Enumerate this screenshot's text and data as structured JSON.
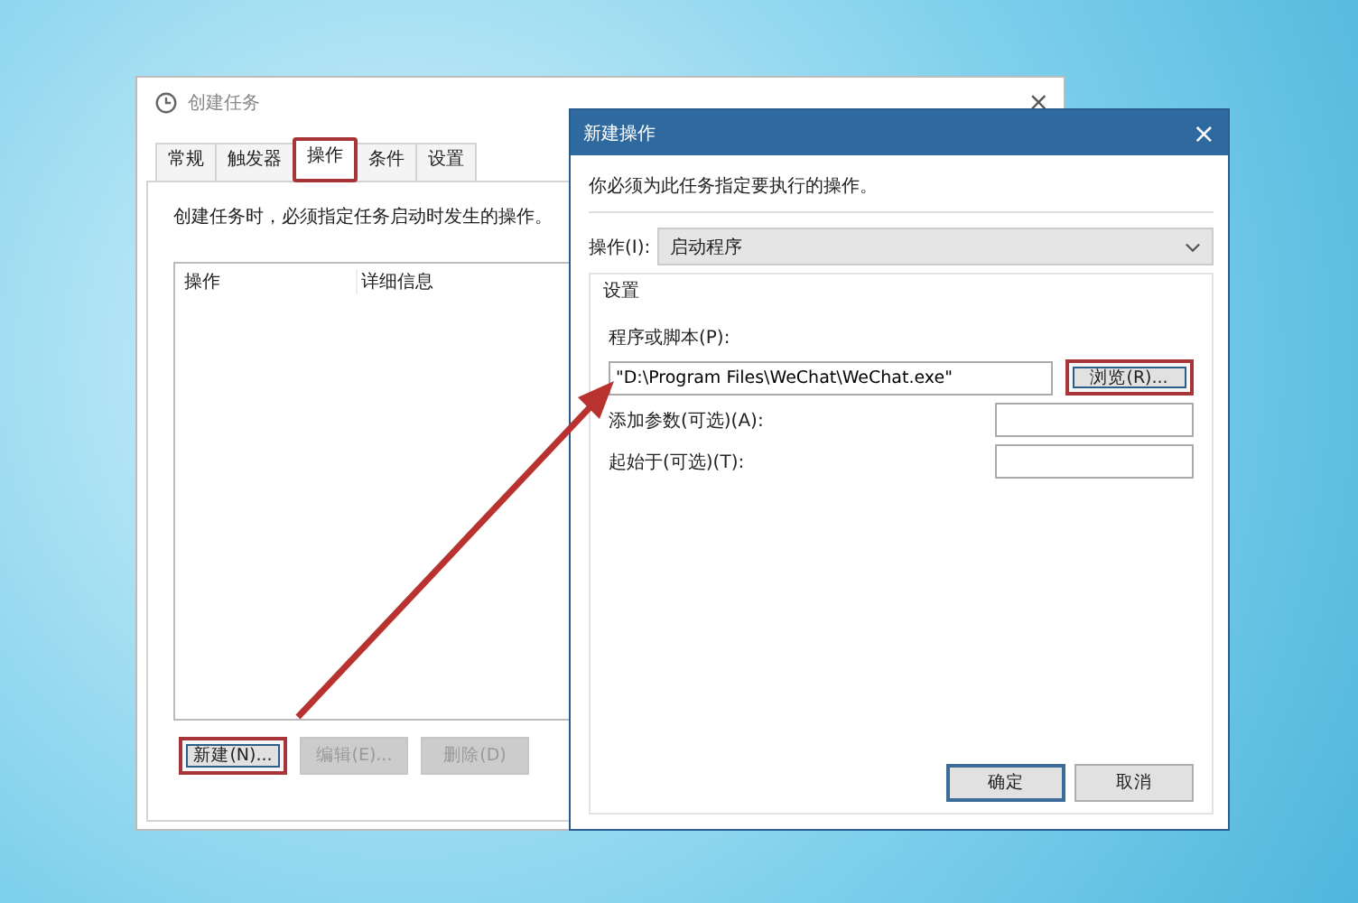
{
  "task_window": {
    "title": "创建任务",
    "tabs": [
      {
        "label": "常规",
        "selected": false,
        "highlighted": false
      },
      {
        "label": "触发器",
        "selected": false,
        "highlighted": false
      },
      {
        "label": "操作",
        "selected": true,
        "highlighted": true
      },
      {
        "label": "条件",
        "selected": false,
        "highlighted": false
      },
      {
        "label": "设置",
        "selected": false,
        "highlighted": false
      }
    ],
    "description": "创建任务时，必须指定任务启动时发生的操作。",
    "table": {
      "columns": [
        "操作",
        "详细信息"
      ]
    },
    "buttons": [
      {
        "label": "新建(N)...",
        "disabled": false,
        "highlighted": true
      },
      {
        "label": "编辑(E)...",
        "disabled": true,
        "highlighted": false
      },
      {
        "label": "删除(D)",
        "disabled": true,
        "highlighted": false
      }
    ]
  },
  "action_dialog": {
    "title": "新建操作",
    "close": "×",
    "instruction": "你必须为此任务指定要执行的操作。",
    "action_label": "操作(I):",
    "action_value": "启动程序",
    "settings_label": "设置",
    "program_label": "程序或脚本(P):",
    "program_value": "\"D:\\Program Files\\WeChat\\WeChat.exe\"",
    "browse_button": {
      "label": "浏览(R)...",
      "highlighted": true
    },
    "arguments_label": "添加参数(可选)(A):",
    "start_in_label": "起始于(可选)(T):",
    "buttons": [
      {
        "label": "确定",
        "default": true
      },
      {
        "label": "取消",
        "default": false
      }
    ]
  }
}
